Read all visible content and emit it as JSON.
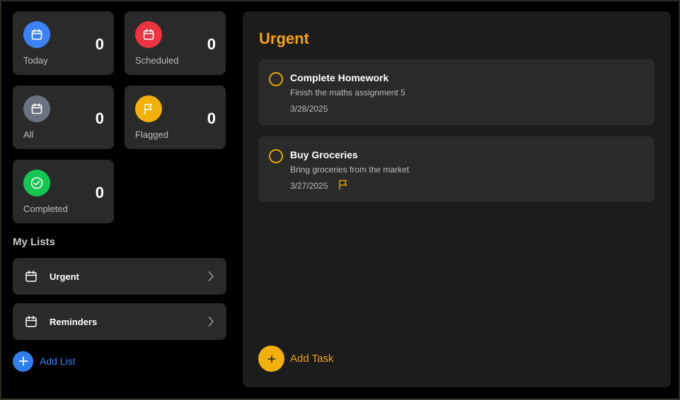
{
  "colors": {
    "today": "#3b82f6",
    "scheduled": "#ef3340",
    "all": "#6b7280",
    "flagged": "#f2b00c",
    "completed": "#16c653",
    "accent": "#f2a30f",
    "link": "#3b82f6"
  },
  "summary": {
    "today": {
      "label": "Today",
      "count": "0",
      "icon": "calendar-icon"
    },
    "scheduled": {
      "label": "Scheduled",
      "count": "0",
      "icon": "calendar-icon"
    },
    "all": {
      "label": "All",
      "count": "0",
      "icon": "calendar-icon"
    },
    "flagged": {
      "label": "Flagged",
      "count": "0",
      "icon": "flag-icon"
    },
    "completed": {
      "label": "Completed",
      "count": "0",
      "icon": "check-circle-icon"
    }
  },
  "lists": {
    "title": "My Lists",
    "items": [
      {
        "label": "Urgent",
        "icon": "calendar-icon"
      },
      {
        "label": "Reminders",
        "icon": "calendar-icon"
      }
    ],
    "add_label": "Add List"
  },
  "main": {
    "title": "Urgent",
    "tasks": [
      {
        "title": "Complete Homework",
        "description": "Finish the maths assignment 5",
        "date": "3/28/2025",
        "flagged": false
      },
      {
        "title": "Buy Groceries",
        "description": "Bring groceries from the market",
        "date": "3/27/2025",
        "flagged": true
      }
    ],
    "add_label": "Add Task"
  }
}
